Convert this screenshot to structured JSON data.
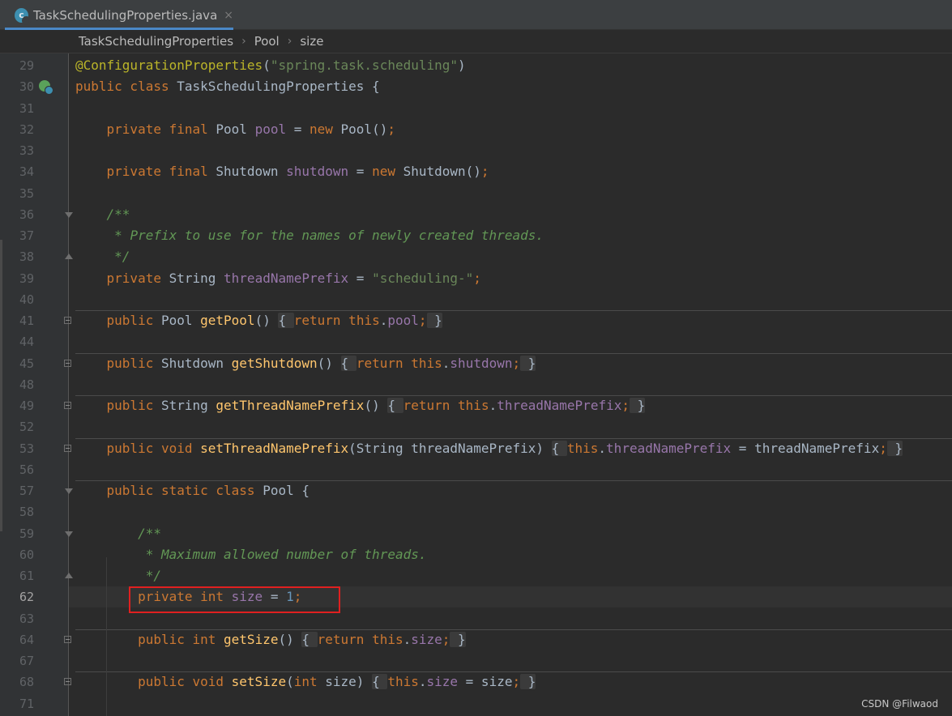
{
  "tab": {
    "icon": "java-class-icon",
    "icon_letter": "c",
    "label": "TaskSchedulingProperties.java",
    "close": "×"
  },
  "breadcrumb": {
    "items": [
      "TaskSchedulingProperties",
      "Pool",
      "size"
    ],
    "separator": "›"
  },
  "lines": [
    {
      "num": "29",
      "tokens": [
        [
          "anno",
          "@ConfigurationProperties"
        ],
        [
          "pl",
          "("
        ],
        [
          "str",
          "\"spring.task.scheduling\""
        ],
        [
          "pl",
          ")"
        ]
      ]
    },
    {
      "num": "30",
      "icon": true,
      "tokens": [
        [
          "kw",
          "public class "
        ],
        [
          "pl",
          "TaskSchedulingProperties {"
        ]
      ]
    },
    {
      "num": "31",
      "tokens": []
    },
    {
      "num": "32",
      "tokens": [
        [
          "pl",
          "    "
        ],
        [
          "kw",
          "private final "
        ],
        [
          "pl",
          "Pool "
        ],
        [
          "fld",
          "pool"
        ],
        [
          "pl",
          " = "
        ],
        [
          "kw",
          "new "
        ],
        [
          "pl",
          "Pool()"
        ],
        [
          "kw",
          ";"
        ]
      ]
    },
    {
      "num": "33",
      "tokens": []
    },
    {
      "num": "34",
      "tokens": [
        [
          "pl",
          "    "
        ],
        [
          "kw",
          "private final "
        ],
        [
          "pl",
          "Shutdown "
        ],
        [
          "fld",
          "shutdown"
        ],
        [
          "pl",
          " = "
        ],
        [
          "kw",
          "new "
        ],
        [
          "pl",
          "Shutdown()"
        ],
        [
          "kw",
          ";"
        ]
      ]
    },
    {
      "num": "35",
      "tokens": []
    },
    {
      "num": "36",
      "fold": "open",
      "tokens": [
        [
          "pl",
          "    "
        ],
        [
          "doc",
          "/**"
        ]
      ]
    },
    {
      "num": "37",
      "tokens": [
        [
          "pl",
          "     "
        ],
        [
          "doc",
          "* Prefix to use for the names of newly created threads."
        ]
      ]
    },
    {
      "num": "38",
      "fold": "close",
      "tokens": [
        [
          "pl",
          "     "
        ],
        [
          "doc",
          "*/"
        ]
      ]
    },
    {
      "num": "39",
      "tokens": [
        [
          "pl",
          "    "
        ],
        [
          "kw",
          "private "
        ],
        [
          "pl",
          "String "
        ],
        [
          "fld",
          "threadNamePrefix"
        ],
        [
          "pl",
          " = "
        ],
        [
          "str",
          "\"scheduling-\""
        ],
        [
          "kw",
          ";"
        ]
      ]
    },
    {
      "num": "40",
      "tokens": []
    },
    {
      "num": "41",
      "sep": true,
      "fold": "box",
      "tokens": [
        [
          "pl",
          "    "
        ],
        [
          "kw",
          "public "
        ],
        [
          "pl",
          "Pool "
        ],
        [
          "fn",
          "getPool"
        ],
        [
          "pl",
          "() "
        ],
        [
          "hl",
          "{ "
        ],
        [
          "kw",
          "return this"
        ],
        [
          "pl",
          "."
        ],
        [
          "fld",
          "pool"
        ],
        [
          "kw",
          ";"
        ],
        [
          "hl",
          " }"
        ]
      ]
    },
    {
      "num": "44",
      "tokens": []
    },
    {
      "num": "45",
      "sep": true,
      "fold": "box",
      "tokens": [
        [
          "pl",
          "    "
        ],
        [
          "kw",
          "public "
        ],
        [
          "pl",
          "Shutdown "
        ],
        [
          "fn",
          "getShutdown"
        ],
        [
          "pl",
          "() "
        ],
        [
          "hl",
          "{ "
        ],
        [
          "kw",
          "return this"
        ],
        [
          "pl",
          "."
        ],
        [
          "fld",
          "shutdown"
        ],
        [
          "kw",
          ";"
        ],
        [
          "hl",
          " }"
        ]
      ]
    },
    {
      "num": "48",
      "tokens": []
    },
    {
      "num": "49",
      "sep": true,
      "fold": "box",
      "tokens": [
        [
          "pl",
          "    "
        ],
        [
          "kw",
          "public "
        ],
        [
          "pl",
          "String "
        ],
        [
          "fn",
          "getThreadNamePrefix"
        ],
        [
          "pl",
          "() "
        ],
        [
          "hl",
          "{ "
        ],
        [
          "kw",
          "return this"
        ],
        [
          "pl",
          "."
        ],
        [
          "fld",
          "threadNamePrefix"
        ],
        [
          "kw",
          ";"
        ],
        [
          "hl",
          " }"
        ]
      ]
    },
    {
      "num": "52",
      "tokens": []
    },
    {
      "num": "53",
      "sep": true,
      "fold": "box",
      "tokens": [
        [
          "pl",
          "    "
        ],
        [
          "kw",
          "public void "
        ],
        [
          "fn",
          "setThreadNamePrefix"
        ],
        [
          "pl",
          "(String threadNamePrefix) "
        ],
        [
          "hl",
          "{ "
        ],
        [
          "kw",
          "this"
        ],
        [
          "pl",
          "."
        ],
        [
          "fld",
          "threadNamePrefix"
        ],
        [
          "pl",
          " = threadNamePrefix"
        ],
        [
          "kw",
          ";"
        ],
        [
          "hl",
          " }"
        ]
      ]
    },
    {
      "num": "56",
      "tokens": []
    },
    {
      "num": "57",
      "sep": true,
      "fold": "open",
      "tokens": [
        [
          "pl",
          "    "
        ],
        [
          "kw",
          "public static class "
        ],
        [
          "pl",
          "Pool {"
        ]
      ]
    },
    {
      "num": "58",
      "tokens": []
    },
    {
      "num": "59",
      "fold": "open",
      "tokens": [
        [
          "pl",
          "        "
        ],
        [
          "doc",
          "/**"
        ]
      ]
    },
    {
      "num": "60",
      "tokens": [
        [
          "pl",
          "         "
        ],
        [
          "doc",
          "* Maximum allowed number of threads."
        ]
      ]
    },
    {
      "num": "61",
      "fold": "close",
      "tokens": [
        [
          "pl",
          "         "
        ],
        [
          "doc",
          "*/"
        ]
      ]
    },
    {
      "num": "62",
      "current": true,
      "tokens": [
        [
          "pl",
          "        "
        ],
        [
          "kw",
          "private int "
        ],
        [
          "fld",
          "size"
        ],
        [
          "pl",
          " = "
        ],
        [
          "num",
          "1"
        ],
        [
          "kw",
          ";"
        ]
      ]
    },
    {
      "num": "63",
      "tokens": []
    },
    {
      "num": "64",
      "sep": true,
      "fold": "box",
      "tokens": [
        [
          "pl",
          "        "
        ],
        [
          "kw",
          "public int "
        ],
        [
          "fn",
          "getSize"
        ],
        [
          "pl",
          "() "
        ],
        [
          "hl",
          "{ "
        ],
        [
          "kw",
          "return this"
        ],
        [
          "pl",
          "."
        ],
        [
          "fld",
          "size"
        ],
        [
          "kw",
          ";"
        ],
        [
          "hl",
          " }"
        ]
      ]
    },
    {
      "num": "67",
      "tokens": []
    },
    {
      "num": "68",
      "sep": true,
      "fold": "box",
      "tokens": [
        [
          "pl",
          "        "
        ],
        [
          "kw",
          "public void "
        ],
        [
          "fn",
          "setSize"
        ],
        [
          "pl",
          "("
        ],
        [
          "kw",
          "int "
        ],
        [
          "pl",
          "size) "
        ],
        [
          "hl",
          "{ "
        ],
        [
          "kw",
          "this"
        ],
        [
          "pl",
          "."
        ],
        [
          "fld",
          "size"
        ],
        [
          "pl",
          " = size"
        ],
        [
          "kw",
          ";"
        ],
        [
          "hl",
          " }"
        ]
      ]
    },
    {
      "num": "71",
      "tokens": []
    }
  ],
  "watermark": "CSDN @Filwaod",
  "colors": {
    "background": "#2b2b2b",
    "keyword": "#cc7832",
    "string": "#6a8759",
    "field": "#9876aa",
    "method": "#ffc66d",
    "doc": "#629755",
    "annotation": "#bbb529",
    "highlight": "#e02020"
  }
}
